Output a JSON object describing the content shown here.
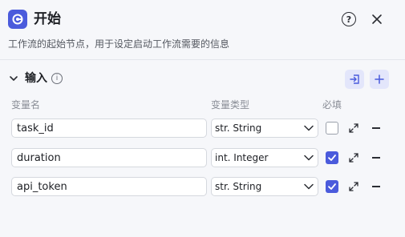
{
  "header": {
    "title": "开始",
    "subtitle": "工作流的起始节点，用于设定启动工作流需要的信息",
    "help_icon_text": "?"
  },
  "input_section": {
    "title": "输入",
    "info_icon_text": "i",
    "columns": {
      "name": "变量名",
      "type": "变量类型",
      "required": "必填"
    },
    "rows": [
      {
        "name": "task_id",
        "type": "str. String",
        "required": false
      },
      {
        "name": "duration",
        "type": "int. Integer",
        "required": true
      },
      {
        "name": "api_token",
        "type": "str. String",
        "required": true
      }
    ]
  },
  "colors": {
    "accent": "#4b5bdc",
    "accent_light": "#e3e6fb",
    "background": "#f6f7fa"
  },
  "icons": [
    "start-logo-icon",
    "help-icon",
    "close-icon",
    "chevron-down-icon",
    "info-icon",
    "import-icon",
    "plus-icon",
    "expand-icon",
    "minus-icon",
    "check-icon"
  ]
}
